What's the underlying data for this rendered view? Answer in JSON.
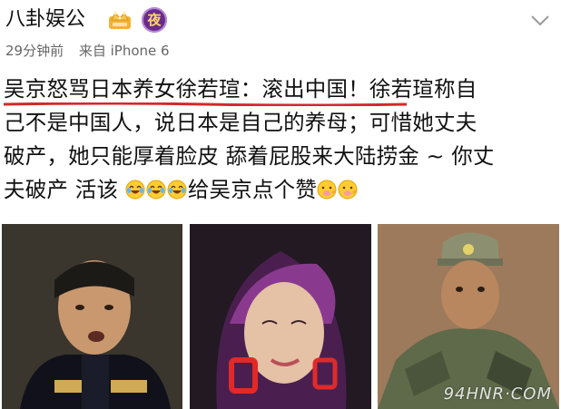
{
  "header": {
    "username": "八卦娱公",
    "night_badge": "夜"
  },
  "meta": {
    "time": "29分钟前",
    "source": "来自 iPhone 6"
  },
  "post": {
    "line1": "吴京怒骂日本养女徐若瑄：滚出中国！徐若瑄称自",
    "line2": "己不是中国人，说日本是自己的养母；可惜她丈夫",
    "line3": "破产，她只能厚着脸皮 舔着屁股来大陆捞金 ~ 你丈",
    "line4_start": "夫破产 活该",
    "line4_mid": "给吴京点个赞"
  },
  "images": {
    "watermark": "94HNR·COM"
  },
  "colors": {
    "underline": "#d62828",
    "night_badge_bg": "#6a2c8b",
    "crown_gold": "#f2b233"
  },
  "icons": {
    "crown": "crown-badge-icon",
    "chevron": "chevron-down-icon",
    "laugh": "tears-of-joy-emoji",
    "clap": "clapping-emoji"
  }
}
